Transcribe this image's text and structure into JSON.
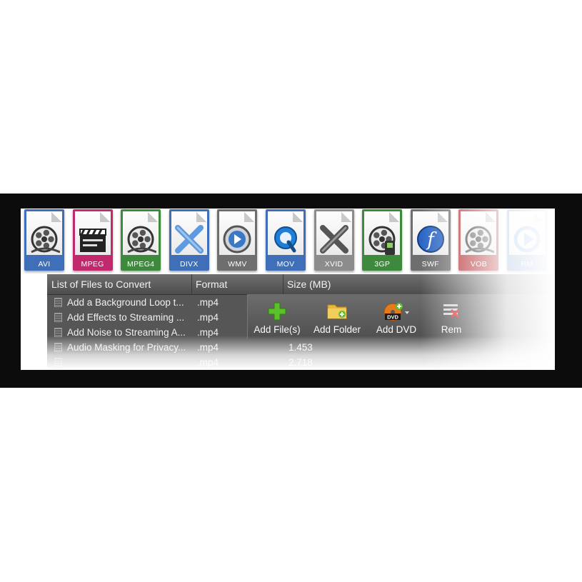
{
  "formats": [
    {
      "label": "AVI",
      "icon": "film-reel-icon",
      "color": "#3f6fb8"
    },
    {
      "label": "MPEG",
      "icon": "clapperboard-icon",
      "color": "#c2286d"
    },
    {
      "label": "MPEG4",
      "icon": "film-reel-icon",
      "color": "#3e8a3c"
    },
    {
      "label": "DIVX",
      "icon": "divx-x-icon",
      "color": "#3f6fb8"
    },
    {
      "label": "WMV",
      "icon": "play-button-icon",
      "color": "#6e6e6e"
    },
    {
      "label": "MOV",
      "icon": "quicktime-icon",
      "color": "#3f6fb8"
    },
    {
      "label": "XVID",
      "icon": "xvid-x-icon",
      "color": "#8c8c8c"
    },
    {
      "label": "3GP",
      "icon": "film-phone-icon",
      "color": "#3e8a3c"
    },
    {
      "label": "SWF",
      "icon": "flash-icon",
      "color": "#6e6e6e"
    },
    {
      "label": "VOB",
      "icon": "film-reel-icon",
      "color": "#b1292c"
    },
    {
      "label": "RM",
      "icon": "real-play-icon",
      "color": "#3f6fb8"
    }
  ],
  "file_list": {
    "columns": {
      "name": "List of Files to Convert",
      "format": "Format",
      "size": "Size (MB)"
    },
    "rows": [
      {
        "name": "Add a Background Loop t...",
        "format": ".mp4",
        "size": ""
      },
      {
        "name": "Add Effects to Streaming ...",
        "format": ".mp4",
        "size": ""
      },
      {
        "name": "Add Noise to Streaming A...",
        "format": ".mp4",
        "size": ""
      },
      {
        "name": "Audio Masking for Privacy...",
        "format": ".mp4",
        "size": "1.453"
      },
      {
        "name": "",
        "format": ".mp4",
        "size": "2.718"
      }
    ]
  },
  "toolbar": {
    "add_files": "Add File(s)",
    "add_folder": "Add Folder",
    "add_dvd": "Add DVD",
    "remove": "Rem",
    "dvd_badge": "DVD"
  },
  "colors": {
    "banner_bg": "#0c0c0c",
    "list_bg": "#565656",
    "add_green": "#5cc02a",
    "folder_yellow": "#e8b836",
    "dvd_orange": "#e47a1c"
  }
}
